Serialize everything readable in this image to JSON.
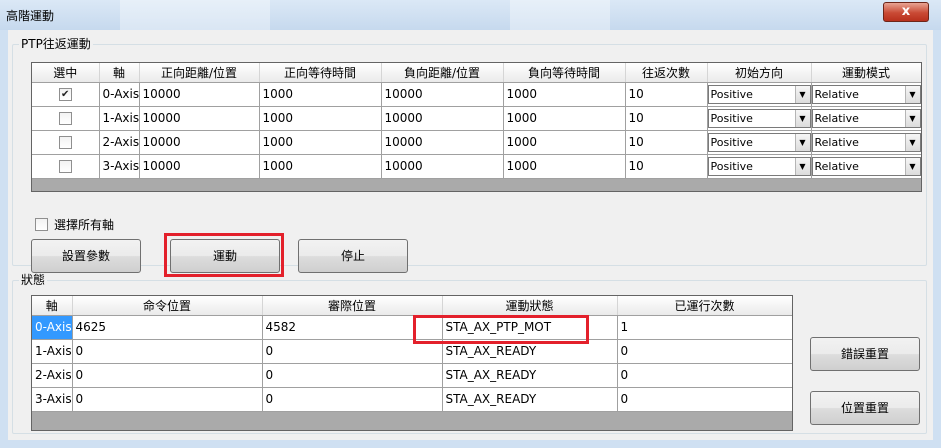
{
  "window": {
    "title": "高階運動",
    "close_label": "x"
  },
  "ptp_group": {
    "title": "PTP往返運動",
    "columns": [
      "選中",
      "軸",
      "正向距離/位置",
      "正向等待時間",
      "負向距離/位置",
      "負向等待時間",
      "往返次數",
      "初始方向",
      "運動模式"
    ],
    "rows": [
      {
        "checked": true,
        "axis": "0-Axis",
        "fwd_dist": "10000",
        "fwd_wait": "1000",
        "rev_dist": "10000",
        "rev_wait": "1000",
        "count": "10",
        "direction": "Positive",
        "mode": "Relative"
      },
      {
        "checked": false,
        "axis": "1-Axis",
        "fwd_dist": "10000",
        "fwd_wait": "1000",
        "rev_dist": "10000",
        "rev_wait": "1000",
        "count": "10",
        "direction": "Positive",
        "mode": "Relative"
      },
      {
        "checked": false,
        "axis": "2-Axis",
        "fwd_dist": "10000",
        "fwd_wait": "1000",
        "rev_dist": "10000",
        "rev_wait": "1000",
        "count": "10",
        "direction": "Positive",
        "mode": "Relative"
      },
      {
        "checked": false,
        "axis": "3-Axis",
        "fwd_dist": "10000",
        "fwd_wait": "1000",
        "rev_dist": "10000",
        "rev_wait": "1000",
        "count": "10",
        "direction": "Positive",
        "mode": "Relative"
      }
    ],
    "select_all_label": "選擇所有軸",
    "buttons": {
      "set_params": "設置參數",
      "move": "運動",
      "stop": "停止"
    }
  },
  "status_group": {
    "title": "狀態",
    "columns": [
      "軸",
      "命令位置",
      "審際位置",
      "運動狀態",
      "已運行次數"
    ],
    "rows": [
      {
        "axis": "0-Axis",
        "cmd_pos": "4625",
        "act_pos": "4582",
        "state": "STA_AX_PTP_MOT",
        "runs": "1"
      },
      {
        "axis": "1-Axis",
        "cmd_pos": "0",
        "act_pos": "0",
        "state": "STA_AX_READY",
        "runs": "0"
      },
      {
        "axis": "2-Axis",
        "cmd_pos": "0",
        "act_pos": "0",
        "state": "STA_AX_READY",
        "runs": "0"
      },
      {
        "axis": "3-Axis",
        "cmd_pos": "0",
        "act_pos": "0",
        "state": "STA_AX_READY",
        "runs": "0"
      }
    ],
    "buttons": {
      "error_reset": "錯誤重置",
      "position_reset": "位置重置"
    }
  },
  "colors": {
    "highlight": "#e3202b",
    "selection": "#3399ff"
  }
}
